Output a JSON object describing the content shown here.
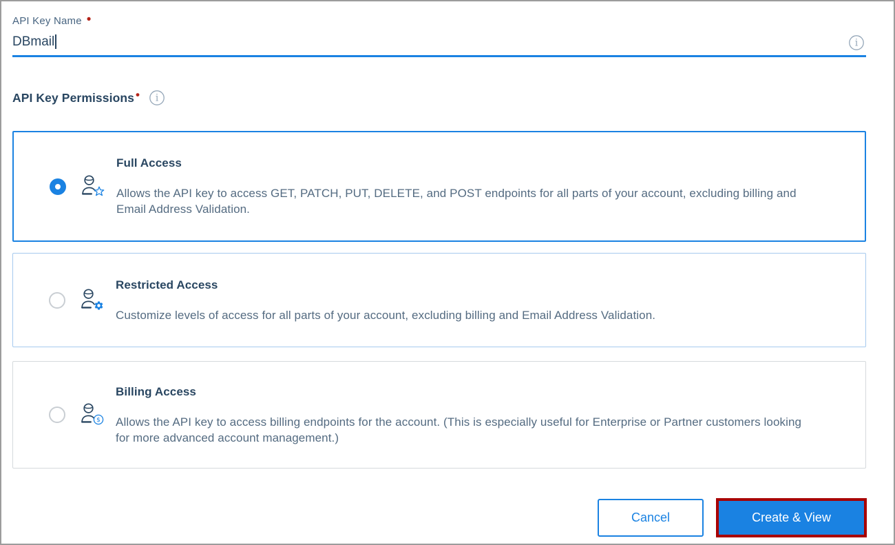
{
  "colors": {
    "accent_blue": "#1A82E2",
    "heading_text": "#294661",
    "body_text": "#546B81",
    "required_dot": "#B42318",
    "annotation_red": "#A80000",
    "selected_card_border": "#1A82E2",
    "restricted_card_border": "#A5C9EE",
    "billing_card_border": "#D5D9DC",
    "page_border": "#9C9C9C"
  },
  "name_field": {
    "label": "API Key Name",
    "required_marker": "•",
    "value": "DBmail"
  },
  "permissions": {
    "heading": "API Key Permissions",
    "required_marker": "•",
    "options": [
      {
        "title": "Full Access",
        "description": "Allows the API key to access GET, PATCH, PUT, DELETE, and POST endpoints for all parts of your account, excluding billing and Email Address Validation.",
        "selected": true,
        "icon": "person-star-icon"
      },
      {
        "title": "Restricted Access",
        "description": "Customize levels of access for all parts of your account, excluding billing and Email Address Validation.",
        "selected": false,
        "icon": "person-gear-icon"
      },
      {
        "title": "Billing Access",
        "description": "Allows the API key to access billing endpoints for the account. (This is especially useful for Enterprise or Partner customers looking for more advanced account management.)",
        "selected": false,
        "icon": "person-dollar-icon"
      }
    ]
  },
  "actions": {
    "cancel_label": "Cancel",
    "create_label": "Create & View"
  },
  "icons": {
    "info_glyph": "i",
    "dollar_glyph": "$"
  }
}
